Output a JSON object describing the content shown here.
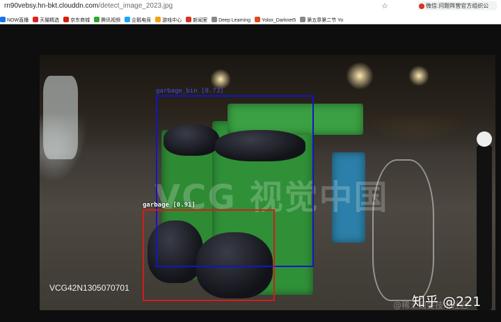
{
  "address_bar": {
    "host": "rn90vebsy.hn-bkt.clouddn.com",
    "path": "/detect_image_2023.jpg",
    "search_chip_text": "微信:问题阵营官方组织公"
  },
  "bookmarks": [
    {
      "label": "NOW直播",
      "color": "#1a73e8"
    },
    {
      "label": "天猫精选",
      "color": "#e02020"
    },
    {
      "label": "京东商城",
      "color": "#d81e06"
    },
    {
      "label": "腾讯视频",
      "color": "#31a531"
    },
    {
      "label": "企鹅电竞",
      "color": "#1aa3ff"
    },
    {
      "label": "游戏中心",
      "color": "#f2a10c"
    },
    {
      "label": "新闻室",
      "color": "#d93025"
    },
    {
      "label": "Deep Learning",
      "color": "#888888"
    },
    {
      "label": "Yolox_Darknet5",
      "color": "#e04a1b"
    },
    {
      "label": "第五章第二节 Yo",
      "color": "#888888"
    }
  ],
  "detections": [
    {
      "label": "garbage_bin [0.73]",
      "color": "#1414c8"
    },
    {
      "label": "garbage [0.91]",
      "color": "#d81a1a"
    }
  ],
  "watermark": "VCG 视觉中国",
  "image_code": "VCG42N1305070701",
  "credit": "知乎 @221",
  "credit_faded": "@稀土掘金技术社区"
}
